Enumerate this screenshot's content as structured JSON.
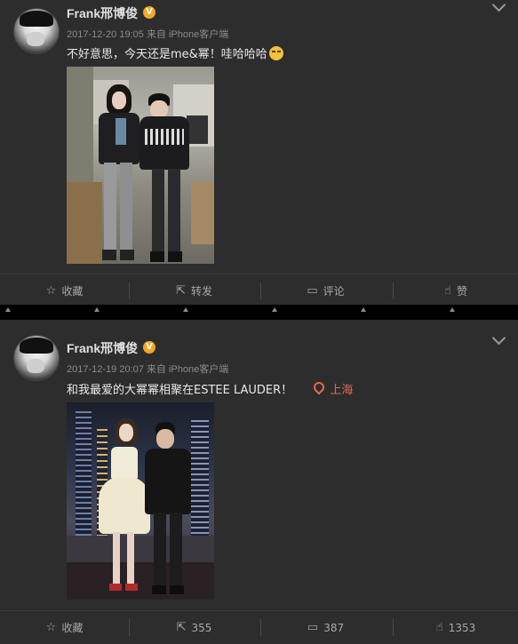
{
  "posts": [
    {
      "user": {
        "name": "Frank邢博俊",
        "verified_badge": "V"
      },
      "meta": {
        "timestamp": "2017-12-20 19:05",
        "source": "来自 iPhone客户端"
      },
      "text": "不好意思，今天还是me&幂！哇哈哈哈",
      "emoji": "smirk-emoji",
      "actions": {
        "favorite": "收藏",
        "repost": "转发",
        "comment": "评论",
        "like": "赞"
      }
    },
    {
      "user": {
        "name": "Frank邢博俊",
        "verified_badge": "V"
      },
      "meta": {
        "timestamp": "2017-12-19 20:07",
        "source": "来自 iPhone客户端"
      },
      "text": "和我最爱的大幂幂相聚在ESTEE LAUDER！",
      "location": "上海",
      "actions": {
        "favorite": "收藏",
        "repost": "355",
        "comment": "387",
        "like": "1353"
      }
    }
  ],
  "icons": {
    "favorite": "star-icon",
    "repost": "share-icon",
    "comment": "comment-icon",
    "like": "thumbs-up-icon",
    "location": "location-pin-icon",
    "menu": "chevron-down-icon"
  },
  "colors": {
    "background": "#2d2d2d",
    "badge": "#f5a623",
    "location": "#e36b4b"
  }
}
